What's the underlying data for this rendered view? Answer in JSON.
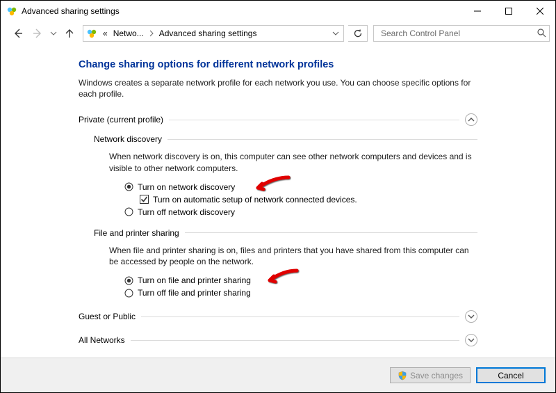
{
  "titlebar": {
    "title": "Advanced sharing settings"
  },
  "navbar": {
    "crumb_prefix": "«",
    "crumbs": [
      "Netwo...",
      "Advanced sharing settings"
    ],
    "search_placeholder": "Search Control Panel"
  },
  "page": {
    "title": "Change sharing options for different network profiles",
    "intro": "Windows creates a separate network profile for each network you use. You can choose specific options for each profile."
  },
  "profiles": [
    {
      "label": "Private (current profile)",
      "expanded": true,
      "sections": [
        {
          "label": "Network discovery",
          "desc": "When network discovery is on, this computer can see other network computers and devices and is visible to other network computers.",
          "options": [
            {
              "type": "radio",
              "label": "Turn on network discovery",
              "checked": true,
              "arrow": true
            },
            {
              "type": "checkbox",
              "label": "Turn on automatic setup of network connected devices.",
              "checked": true,
              "indent": true
            },
            {
              "type": "radio",
              "label": "Turn off network discovery",
              "checked": false
            }
          ]
        },
        {
          "label": "File and printer sharing",
          "desc": "When file and printer sharing is on, files and printers that you have shared from this computer can be accessed by people on the network.",
          "options": [
            {
              "type": "radio",
              "label": "Turn on file and printer sharing",
              "checked": true,
              "arrow": true
            },
            {
              "type": "radio",
              "label": "Turn off file and printer sharing",
              "checked": false
            }
          ]
        }
      ]
    },
    {
      "label": "Guest or Public",
      "expanded": false
    },
    {
      "label": "All Networks",
      "expanded": false
    }
  ],
  "footer": {
    "save": "Save changes",
    "cancel": "Cancel"
  }
}
